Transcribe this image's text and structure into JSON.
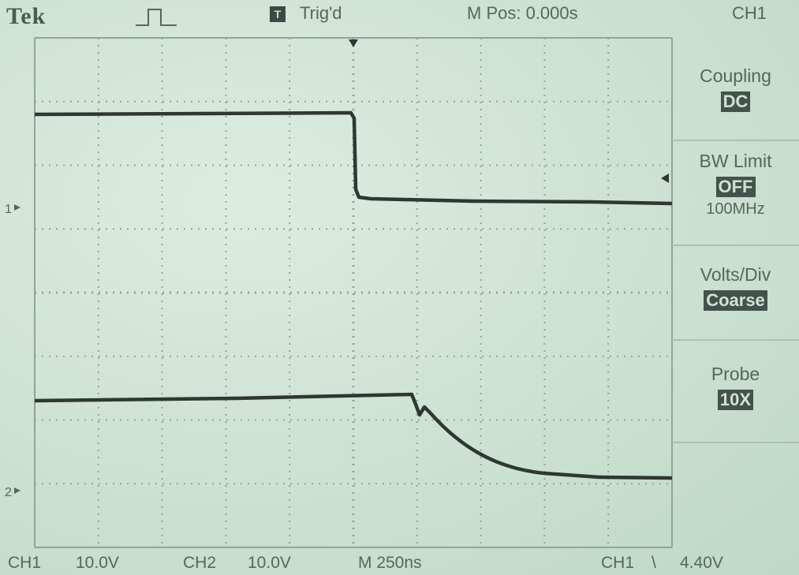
{
  "header": {
    "brand": "Tek",
    "acquisition_icon": "pulse-waveform-icon",
    "trigger_icon_letter": "T",
    "trigger_status": "Trig'd",
    "main_position": "M Pos: 0.000s",
    "menu_title": "CH1"
  },
  "menu": [
    {
      "label": "Coupling",
      "value": "DC",
      "sub": ""
    },
    {
      "label": "BW Limit",
      "value": "OFF",
      "sub": "100MHz"
    },
    {
      "label": "Volts/Div",
      "value": "Coarse",
      "sub": ""
    },
    {
      "label": "Probe",
      "value": "10X",
      "sub": ""
    }
  ],
  "markers": {
    "ch1_ground": "1",
    "ch2_ground": "2"
  },
  "status": {
    "ch1_label": "CH1",
    "ch1_scale": "10.0V",
    "ch2_label": "CH2",
    "ch2_scale": "10.0V",
    "timebase": "M 250ns",
    "trigger_source": "CH1",
    "trigger_slope": "\\",
    "trigger_level": "4.40V"
  },
  "colors": {
    "background": "#cfe3d4",
    "trace": "#2e3733",
    "grid": "#8fa59a",
    "text": "#56665f"
  }
}
